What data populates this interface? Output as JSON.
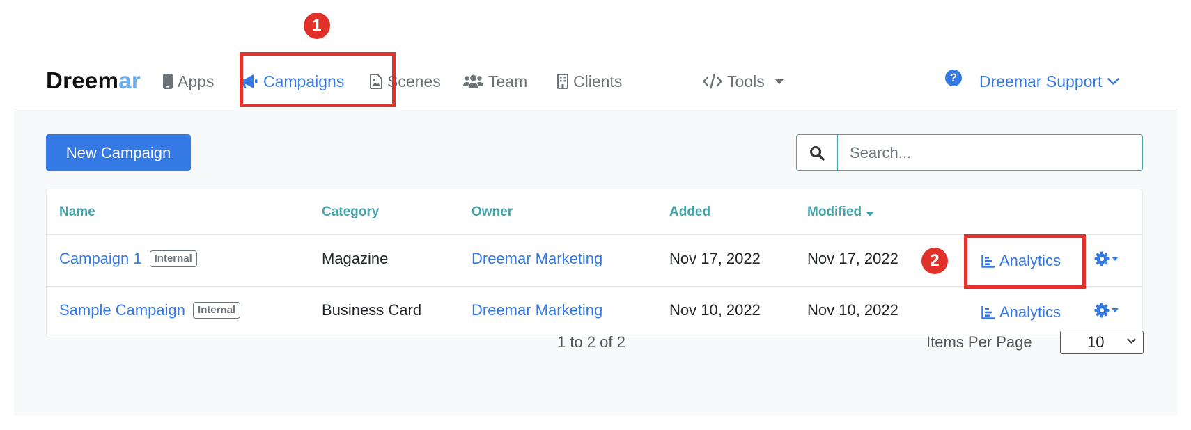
{
  "brand": {
    "logo_main": "Dreem",
    "logo_accent": "ar"
  },
  "nav": {
    "items": [
      {
        "label": "Apps",
        "icon": "mobile-icon"
      },
      {
        "label": "Campaigns",
        "icon": "megaphone-icon"
      },
      {
        "label": "Scenes",
        "icon": "file-image-icon"
      },
      {
        "label": "Team",
        "icon": "users-icon"
      },
      {
        "label": "Clients",
        "icon": "building-icon"
      },
      {
        "label": "Tools",
        "icon": "code-icon"
      }
    ],
    "user_label": "Dreemar Support",
    "help_glyph": "?"
  },
  "annotations": {
    "marker1": "1",
    "marker2": "2",
    "highlight_color": "#e0322a"
  },
  "toolbar": {
    "new_button": "New Campaign",
    "search_placeholder": "Search..."
  },
  "table": {
    "headers": [
      "Name",
      "Category",
      "Owner",
      "Added",
      "Modified"
    ],
    "rows": [
      {
        "name": "Campaign 1",
        "badge": "Internal",
        "category": "Magazine",
        "owner": "Dreemar Marketing",
        "added": "Nov 17, 2022",
        "modified": "Nov 17, 2022",
        "action": "Analytics"
      },
      {
        "name": "Sample Campaign",
        "badge": "Internal",
        "category": "Business Card",
        "owner": "Dreemar Marketing",
        "added": "Nov 10, 2022",
        "modified": "Nov 10, 2022",
        "action": "Analytics"
      }
    ]
  },
  "pagination": {
    "summary": "1 to 2 of 2",
    "items_per_page_label": "Items Per Page",
    "items_per_page_value": "10"
  },
  "colors": {
    "primary": "#3579e5",
    "teal": "#45a3ab",
    "annotation_red": "#e0322a"
  }
}
